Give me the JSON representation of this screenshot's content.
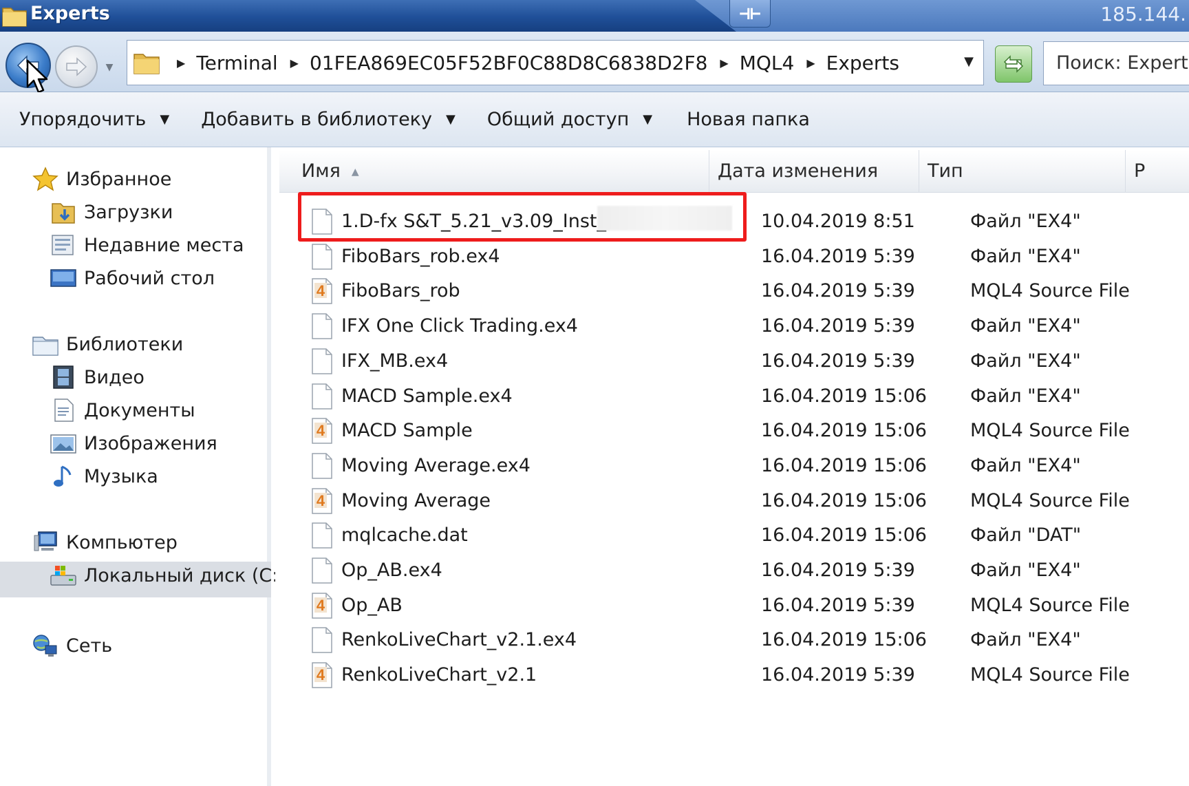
{
  "window": {
    "title": "Experts",
    "ip": "185.144."
  },
  "address": {
    "crumbs": [
      "Terminal",
      "01FEA869EC05F52BF0C88D8C6838D2F8",
      "MQL4",
      "Experts"
    ],
    "search_placeholder": "Поиск: Experts"
  },
  "commands": [
    {
      "label": "Упорядочить",
      "has_arrow": true
    },
    {
      "label": "Добавить в библиотеку",
      "has_arrow": true
    },
    {
      "label": "Общий доступ",
      "has_arrow": true
    },
    {
      "label": "Новая папка",
      "has_arrow": false
    }
  ],
  "sidebar": {
    "favorites": "Избранное",
    "downloads": "Загрузки",
    "recent": "Недавние места",
    "desktop": "Рабочий стол",
    "libraries": "Библиотеки",
    "video": "Видео",
    "documents": "Документы",
    "images": "Изображения",
    "music": "Музыка",
    "computer": "Компьютер",
    "local_disk": "Локальный диск (C:)",
    "network": "Сеть"
  },
  "columns": {
    "name": "Имя",
    "date": "Дата изменения",
    "type": "Тип",
    "size": "Р"
  },
  "files": [
    {
      "name": "1.D-fx S&T_5.21_v3.09_Inst_",
      "date": "10.04.2019 8:51",
      "type": "Файл \"EX4\"",
      "icon": "file-icon"
    },
    {
      "name": "FiboBars_rob.ex4",
      "date": "16.04.2019 5:39",
      "type": "Файл \"EX4\"",
      "icon": "file-icon"
    },
    {
      "name": "FiboBars_rob",
      "date": "16.04.2019 5:39",
      "type": "MQL4 Source File",
      "icon": "mql4-file-icon"
    },
    {
      "name": "IFX One Click Trading.ex4",
      "date": "16.04.2019 5:39",
      "type": "Файл \"EX4\"",
      "icon": "file-icon"
    },
    {
      "name": "IFX_MB.ex4",
      "date": "16.04.2019 5:39",
      "type": "Файл \"EX4\"",
      "icon": "file-icon"
    },
    {
      "name": "MACD Sample.ex4",
      "date": "16.04.2019 15:06",
      "type": "Файл \"EX4\"",
      "icon": "file-icon"
    },
    {
      "name": "MACD Sample",
      "date": "16.04.2019 15:06",
      "type": "MQL4 Source File",
      "icon": "mql4-file-icon"
    },
    {
      "name": "Moving Average.ex4",
      "date": "16.04.2019 15:06",
      "type": "Файл \"EX4\"",
      "icon": "file-icon"
    },
    {
      "name": "Moving Average",
      "date": "16.04.2019 15:06",
      "type": "MQL4 Source File",
      "icon": "mql4-file-icon"
    },
    {
      "name": "mqlcache.dat",
      "date": "16.04.2019 15:06",
      "type": "Файл \"DAT\"",
      "icon": "file-icon"
    },
    {
      "name": "Op_AB.ex4",
      "date": "16.04.2019 5:39",
      "type": "Файл \"EX4\"",
      "icon": "file-icon"
    },
    {
      "name": "Op_AB",
      "date": "16.04.2019 5:39",
      "type": "MQL4 Source File",
      "icon": "mql4-file-icon"
    },
    {
      "name": "RenkoLiveChart_v2.1.ex4",
      "date": "16.04.2019 15:06",
      "type": "Файл \"EX4\"",
      "icon": "file-icon"
    },
    {
      "name": "RenkoLiveChart_v2.1",
      "date": "16.04.2019 5:39",
      "type": "MQL4 Source File",
      "icon": "mql4-file-icon"
    }
  ],
  "mql4_icon_glyph": "4",
  "colors": {
    "highlight": "#ee1c1c",
    "titlebar": "#1f4f98"
  }
}
